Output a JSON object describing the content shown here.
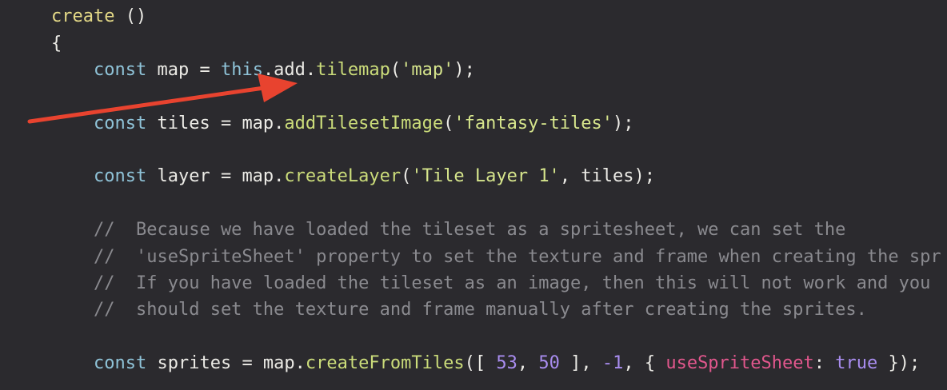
{
  "code": {
    "l1": {
      "name": "create",
      "rest": " ()"
    },
    "l2": {
      "brace": "{"
    },
    "l3": {
      "kw": "const",
      "a": " map = ",
      "this": "this",
      "b": ".add.",
      "fn": "tilemap",
      "c": "(",
      "str": "'map'",
      "d": ");"
    },
    "l4": {
      "kw": "const",
      "a": " tiles = map.",
      "fn": "addTilesetImage",
      "c": "(",
      "str": "'fantasy-tiles'",
      "d": ");"
    },
    "l5": {
      "kw": "const",
      "a": " layer = map.",
      "fn": "createLayer",
      "c": "(",
      "str": "'Tile Layer 1'",
      "d": ", tiles);"
    },
    "c1": "//  Because we have loaded the tileset as a spritesheet, we can set the",
    "c2": "//  'useSpriteSheet' property to set the texture and frame when creating the spr",
    "c3": "//  If you have loaded the tileset as an image, then this will not work and you",
    "c4": "//  should set the texture and frame manually after creating the sprites.",
    "l6": {
      "kw": "const",
      "a": " sprites = map.",
      "fn": "createFromTiles",
      "b": "([ ",
      "n1": "53",
      "sep": ", ",
      "n2": "50",
      "c": " ], ",
      "n3": "-1",
      "d": ", { ",
      "prop": "useSpriteSheet",
      "e": ": ",
      "bool": "true",
      "f": " });"
    }
  },
  "colors": {
    "background": "#2b2a2e",
    "arrow": "#e8432f"
  }
}
